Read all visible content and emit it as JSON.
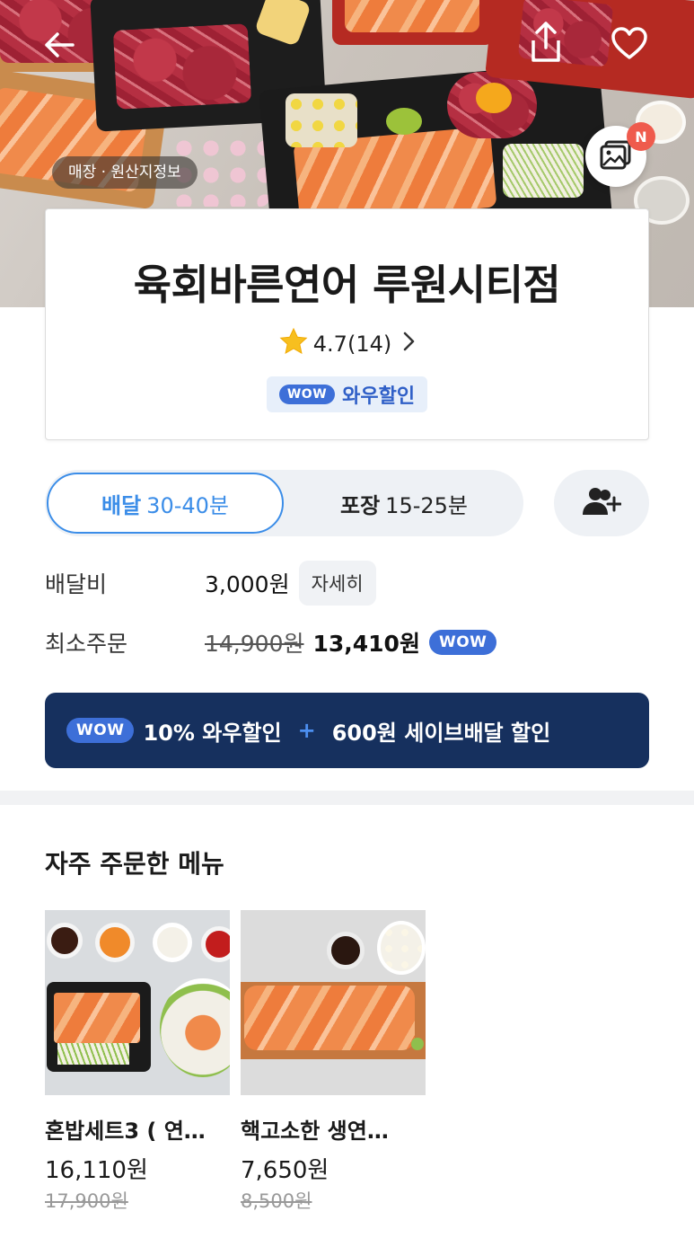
{
  "hero": {
    "origin_info_label": "매장 · 원산지정보",
    "photo_badge": "N"
  },
  "store": {
    "name": "육회바른연어 루원시티점",
    "rating": "4.7",
    "review_count": "(14)",
    "wow_logo": "WOW",
    "wow_label": "와우할인"
  },
  "order_mode": {
    "delivery_label": "배달",
    "delivery_time": "30-40분",
    "takeout_label": "포장",
    "takeout_time": "15-25분"
  },
  "fees": {
    "delivery_fee_label": "배달비",
    "delivery_fee_value": "3,000원",
    "detail_button": "자세히",
    "min_order_label": "최소주문",
    "min_order_original": "14,900원",
    "min_order_discounted": "13,410원",
    "wow_logo": "WOW"
  },
  "wow_banner": {
    "logo": "WOW",
    "discount_text": "10% 와우할인",
    "plus": "+",
    "save_text": "600원 세이브배달 할인"
  },
  "frequent_menu": {
    "title": "자주 주문한 메뉴",
    "items": [
      {
        "name": "혼밥세트3 ( 연…",
        "price": "16,110원",
        "original_price": "17,900원"
      },
      {
        "name": "핵고소한 생연…",
        "price": "7,650원",
        "original_price": "8,500원"
      }
    ]
  },
  "colors": {
    "accent_blue": "#3b8de8",
    "wow_blue": "#3d6fd8",
    "banner_navy": "#16305e",
    "badge_red": "#ef5b4d"
  }
}
